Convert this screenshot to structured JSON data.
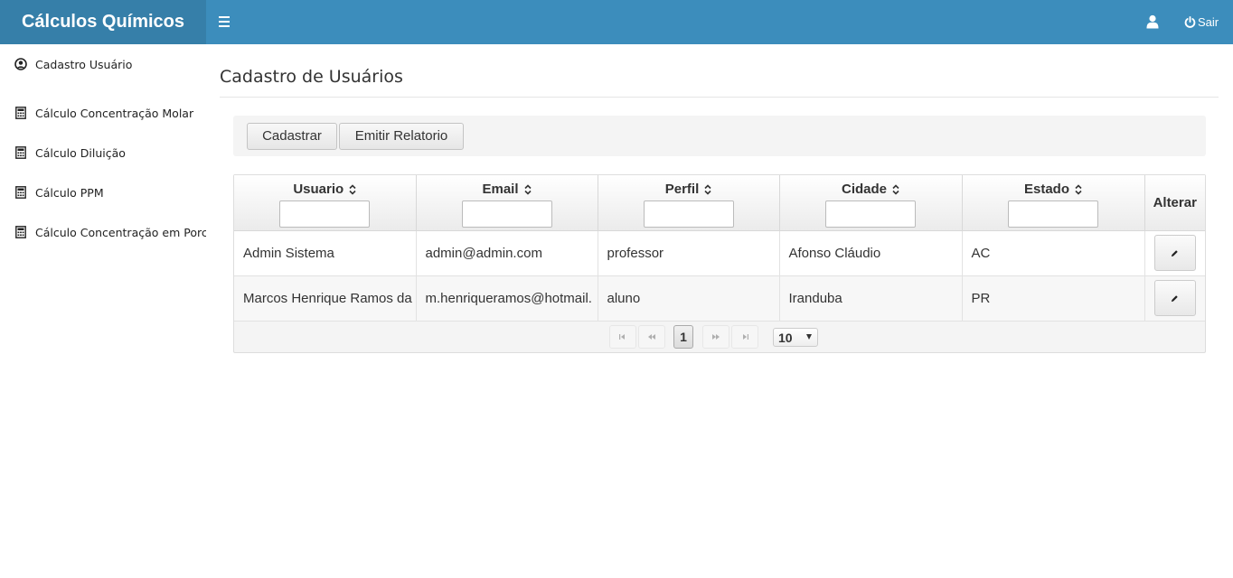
{
  "app": {
    "title": "Cálculos Químicos",
    "brand_color": "#367fa9",
    "header_color": "#3c8dbc"
  },
  "header": {
    "menu_icon": "hamburger-icon",
    "user_icon": "user-icon",
    "logout_icon": "power-icon",
    "logout_label": "Sair"
  },
  "sidebar": {
    "items": [
      {
        "label": "Cadastro Usuário",
        "icon": "user-circle-icon"
      },
      {
        "label": "Cálculo Concentração Molar",
        "icon": "calculator-icon"
      },
      {
        "label": "Cálculo Diluição",
        "icon": "calculator-icon"
      },
      {
        "label": "Cálculo PPM",
        "icon": "calculator-icon"
      },
      {
        "label": "Cálculo Concentração em Porcentagem",
        "icon": "calculator-icon"
      }
    ]
  },
  "main": {
    "title": "Cadastro de Usuários",
    "toolbar": {
      "register_label": "Cadastrar",
      "report_label": "Emitir Relatorio"
    },
    "table": {
      "columns": [
        "Usuario",
        "Email",
        "Perfil",
        "Cidade",
        "Estado",
        "Alterar"
      ],
      "filters": [
        "",
        "",
        "",
        "",
        ""
      ],
      "rows": [
        [
          "Admin Sistema",
          "admin@admin.com",
          "professor",
          "Afonso Cláudio",
          "AC"
        ],
        [
          "Marcos Henrique Ramos da",
          "m.henriqueramos@hotmail.",
          "aluno",
          "Iranduba",
          "PR"
        ]
      ]
    },
    "pagination": {
      "current_page": "1",
      "rows_per_page": "10"
    }
  }
}
